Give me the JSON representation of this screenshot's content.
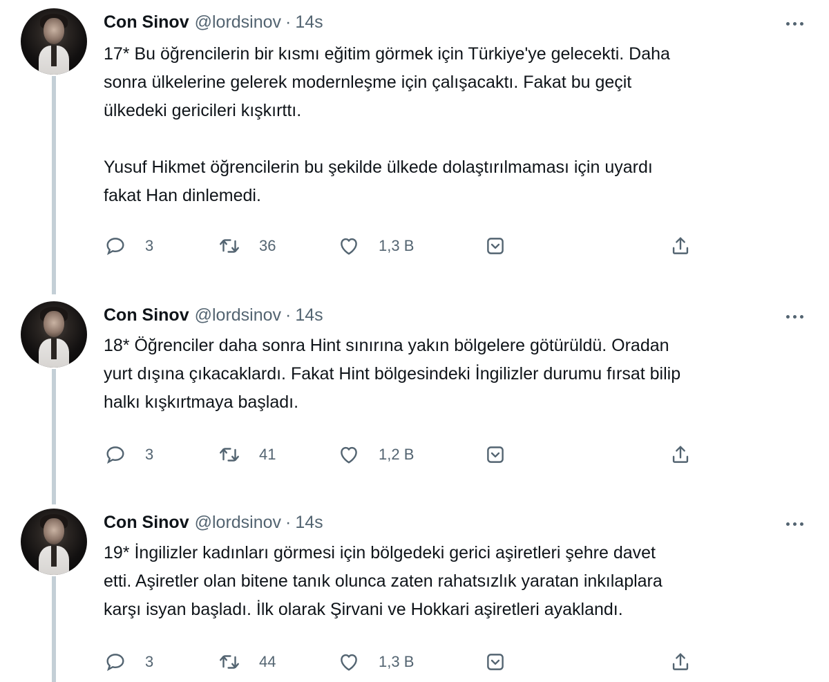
{
  "colors": {
    "text": "#0f1419",
    "muted": "#536471",
    "thread_line": "#c4cfd6",
    "background": "#ffffff"
  },
  "tweets": [
    {
      "author_name": "Con Sinov",
      "handle": "@lordsinov",
      "separator": "·",
      "time": "14s",
      "text": "17* Bu öğrencilerin bir kısmı eğitim görmek için Türkiye'ye gelecekti. Daha\nsonra ülkelerine gelerek modernleşme için çalışacaktı. Fakat bu geçit\nülkedeki gericileri kışkırttı.\n\nYusuf Hikmet öğrencilerin bu şekilde ülkede dolaştırılmaması için uyardı\nfakat Han dinlemedi.",
      "replies": "3",
      "retweets": "36",
      "likes": "1,3 B"
    },
    {
      "author_name": "Con Sinov",
      "handle": "@lordsinov",
      "separator": "·",
      "time": "14s",
      "text": "18* Öğrenciler daha sonra Hint sınırına yakın bölgelere götürüldü. Oradan\nyurt dışına çıkacaklardı. Fakat Hint bölgesindeki İngilizler durumu fırsat bilip\nhalkı kışkırtmaya başladı.",
      "replies": "3",
      "retweets": "41",
      "likes": "1,2 B"
    },
    {
      "author_name": "Con Sinov",
      "handle": "@lordsinov",
      "separator": "·",
      "time": "14s",
      "text": "19* İngilizler kadınları görmesi için bölgedeki gerici aşiretleri şehre davet\netti. Aşiretler olan bitene tanık olunca zaten rahatsızlık yaratan inkılaplara\nkarşı isyan başladı. İlk olarak Şirvani ve Hokkari aşiretleri ayaklandı.",
      "replies": "3",
      "retweets": "44",
      "likes": "1,3 B"
    }
  ],
  "icons": {
    "reply": "reply-icon",
    "retweet": "retweet-icon",
    "like": "heart-icon",
    "bookmark": "bookmark-icon",
    "share": "share-icon",
    "more": "more-icon"
  }
}
